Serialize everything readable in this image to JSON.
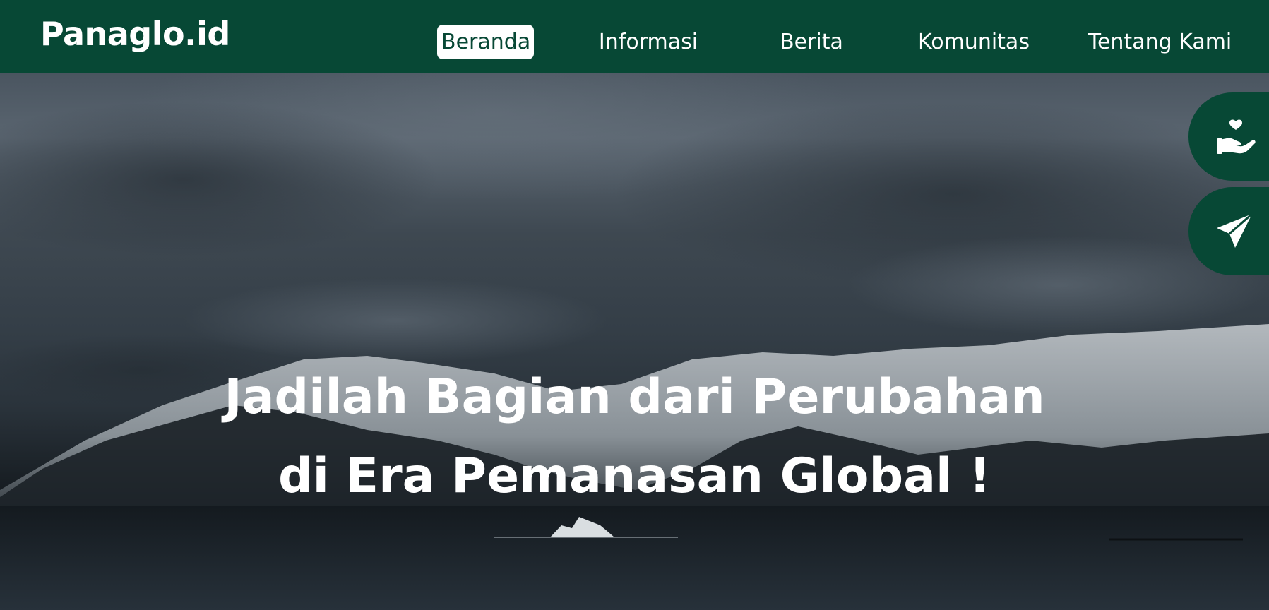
{
  "brand": {
    "name": "Panaglo.id"
  },
  "nav": {
    "items": [
      {
        "label": "Beranda",
        "active": true
      },
      {
        "label": "Informasi",
        "active": false
      },
      {
        "label": "Berita",
        "active": false
      },
      {
        "label": "Komunitas",
        "active": false
      },
      {
        "label": "Tentang Kami",
        "active": false
      }
    ]
  },
  "hero": {
    "headline_line1": "Jadilah Bagian dari Perubahan",
    "headline_line2": "di Era Pemanasan Global !"
  },
  "floating_actions": [
    {
      "icon": "donate-hand-heart-icon"
    },
    {
      "icon": "send-paper-plane-icon"
    }
  ],
  "colors": {
    "brand_green": "#074835",
    "text_white": "#ffffff"
  }
}
